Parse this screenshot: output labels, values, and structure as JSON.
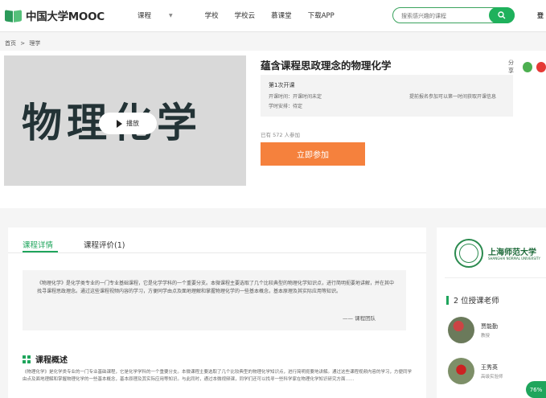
{
  "header": {
    "logo_text": "中国大学MOOC",
    "nav": [
      "课程",
      "学校",
      "学校云",
      "慕课堂",
      "下载APP"
    ],
    "search_placeholder": "搜索感兴趣的课程",
    "login": "登"
  },
  "breadcrumb": [
    "首页",
    ">",
    "理学"
  ],
  "course": {
    "cover_text": "物理化学",
    "play_label": "播放",
    "title": "蕴含课程思政理念的物理化学",
    "share_label": "分享",
    "term_name": "第1次开课",
    "term_time": "开课时间：开课时间未定",
    "term_note": "提前报名参加可以第一时间获取开课信息",
    "term_plan": "学时安排：待定",
    "joined": "已有 572 人参加",
    "join_button": "立即参加"
  },
  "tabs": [
    "课程详情",
    "课程评价(1)"
  ],
  "intro": {
    "text": "《物理化学》是化学类专业的一门专业基础课程，它是化学学科的一个重要分支。本微课程主要选取了几个比较典型的物理化学知识点，进行简明扼要地讲解，并在其中找寻课程思政理念。通过这些课程视频内容的学习，方便同学由点及面地理解和掌握物理化学的一些基本概念，基本原理及其实际应用等知识。",
    "signature": "—— 课程团队"
  },
  "overview": {
    "heading": "课程概述",
    "text": "《物理化学》是化学类专业的一门专业基础课程，它是化学学科的一个重要分支。本微课程主要选取了几个比较典型的物理化学知识点，进行简明扼要地讲解。通过这些课程视频内容的学习，方便同学由点及面地理解和掌握物理化学的一些基本概念，基本原理及其实际应用等知识。与此同时，通过本微视频课，同学们还可以找寻一些科学家在物理化学知识研究方面……"
  },
  "sidebar": {
    "school_name": "上海师范大学",
    "school_en": "SHANGHAI NORMAL UNIVERSITY",
    "teachers_heading": "2 位授课老师",
    "teachers": [
      {
        "name": "贾能勤",
        "title": "教授"
      },
      {
        "name": "王秀英",
        "title": "高级实验师"
      }
    ]
  },
  "progress_badge": "76%"
}
